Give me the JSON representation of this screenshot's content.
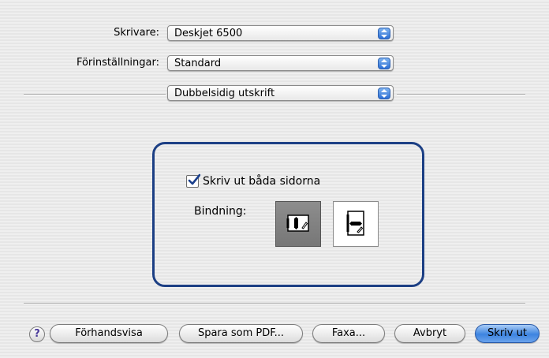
{
  "printer": {
    "label": "Skrivare:",
    "value": "Deskjet 6500"
  },
  "presets": {
    "label": "Förinställningar:",
    "value": "Standard"
  },
  "panel": {
    "value": "Dubbelsidig utskrift"
  },
  "duplex": {
    "checkbox_label": "Skriv ut båda sidorna",
    "checked": true,
    "binding_label": "Bindning:",
    "binding_options": [
      "long-edge",
      "short-edge"
    ],
    "binding_selected": "long-edge"
  },
  "footer": {
    "help": "?",
    "preview": "Förhandsvisa",
    "save_pdf": "Spara som PDF...",
    "fax": "Faxa...",
    "cancel": "Avbryt",
    "print": "Skriv ut"
  },
  "colors": {
    "accent": "#3d84e0",
    "box_border": "#1c3f84"
  }
}
